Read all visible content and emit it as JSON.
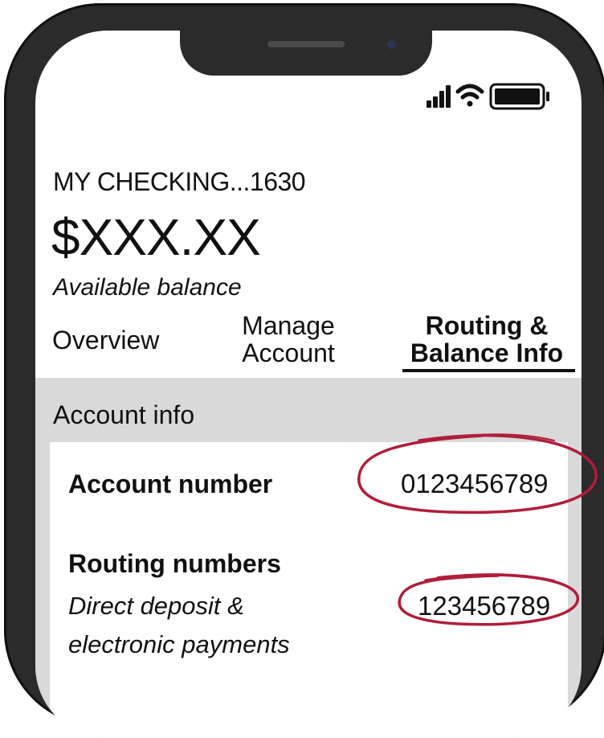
{
  "status_bar": {
    "signal_icon": "signal-bars-icon",
    "wifi_icon": "wifi-icon",
    "battery_icon": "battery-icon"
  },
  "account": {
    "name": "MY CHECKING...1630",
    "balance": "$XXX.XX",
    "balance_label": "Available balance"
  },
  "tabs": [
    {
      "label": "Overview",
      "active": false
    },
    {
      "label_line1": "Manage",
      "label_line2": "Account",
      "active": false
    },
    {
      "label_line1": "Routing &",
      "label_line2": "Balance Info",
      "active": true
    }
  ],
  "info": {
    "section_title": "Account info",
    "account_number_label": "Account number",
    "account_number_value": "0123456789",
    "routing_label": "Routing numbers",
    "routing_sub_line1": "Direct deposit &",
    "routing_sub_line2": "electronic payments",
    "routing_value": "123456789"
  },
  "colors": {
    "highlight": "#b01e3a",
    "panel": "#d9d9d9",
    "phone_frame": "#2b2b2b"
  }
}
